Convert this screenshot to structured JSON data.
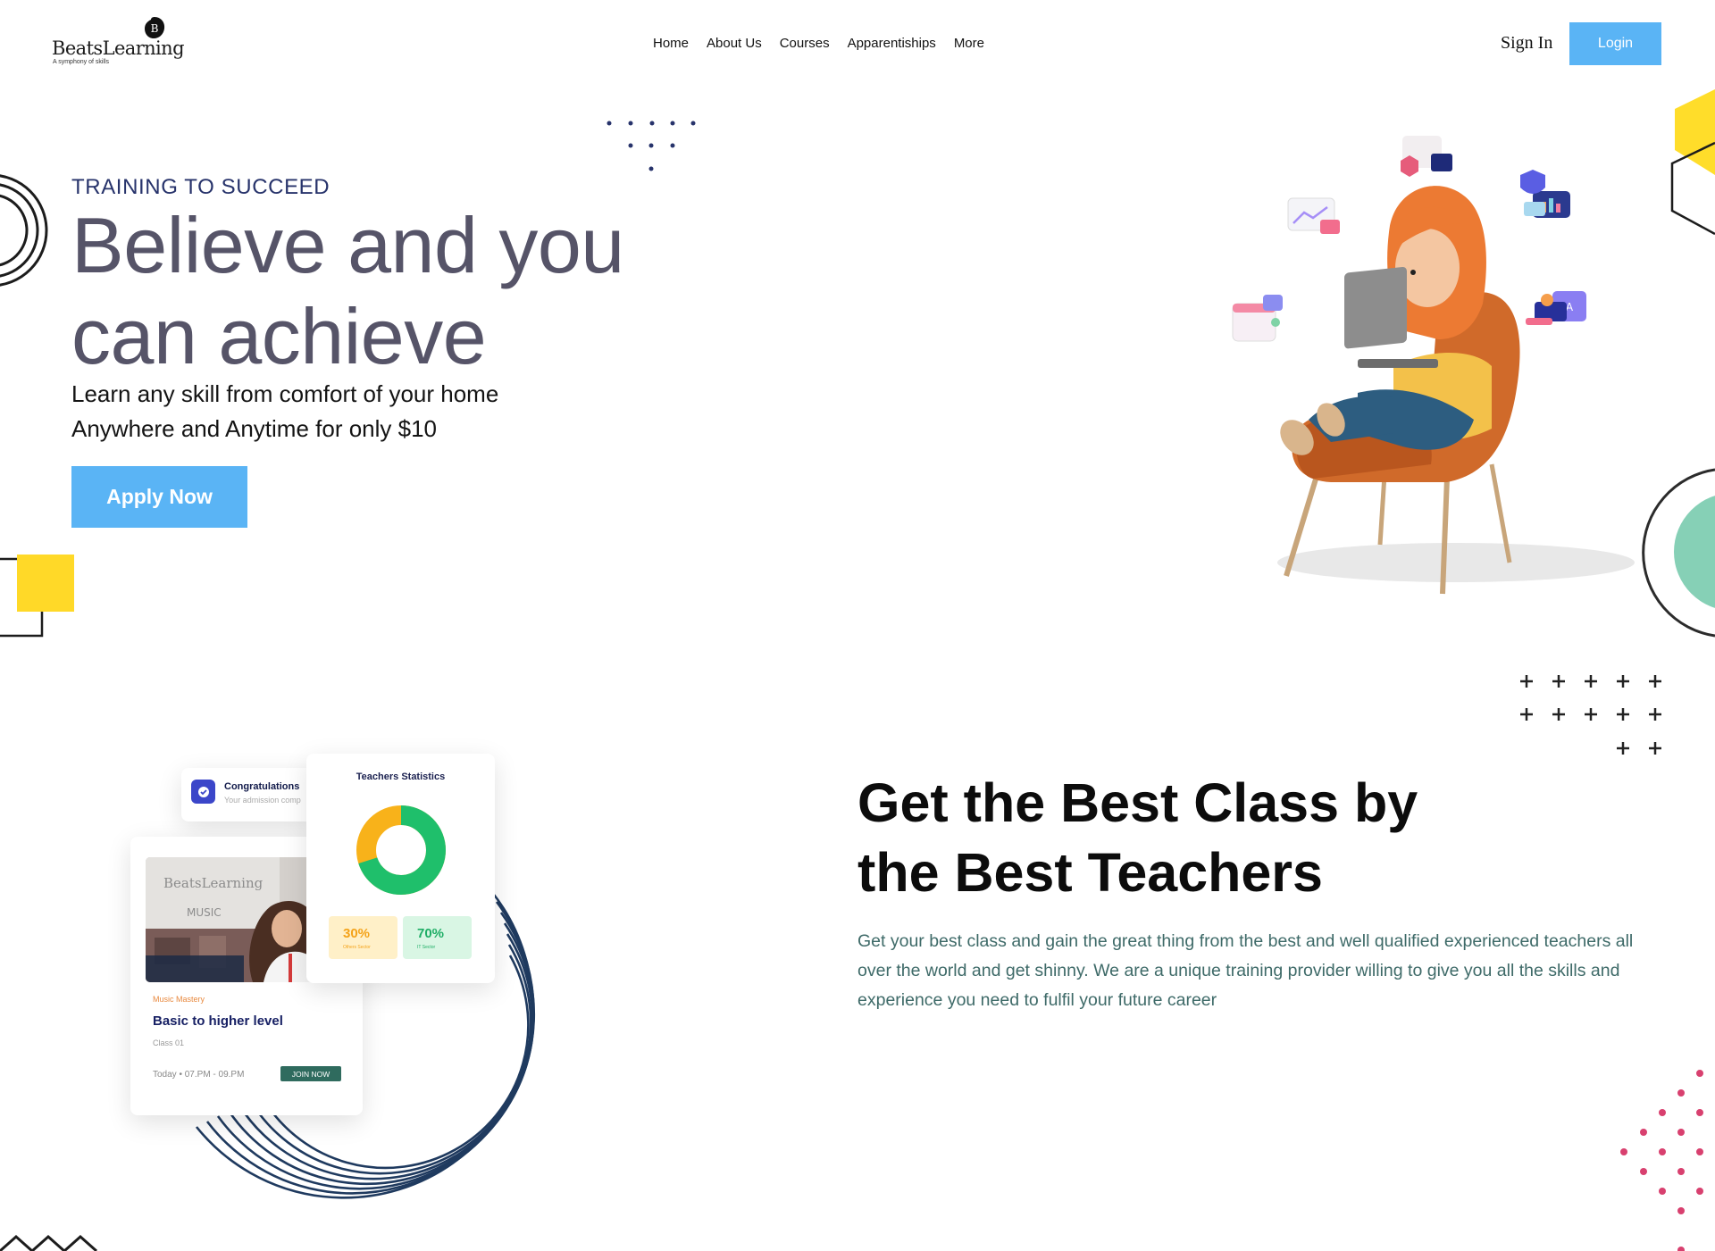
{
  "brand": {
    "name": "BeatsLearning",
    "tagline": "A symphony of skills",
    "badge_letter": "B",
    "accent": "#5ab4f5"
  },
  "nav": {
    "items": [
      "Home",
      "About Us",
      "Courses",
      "Apparentiships",
      "More"
    ],
    "sign_in": "Sign In",
    "login": "Login"
  },
  "hero": {
    "eyebrow": "TRAINING TO SUCCEED",
    "headline_line1": "Believe and you",
    "headline_line2": "can achieve",
    "sub_line1": "Learn any skill from comfort of your home",
    "sub_line2": "Anywhere and Anytime for only $10",
    "cta": "Apply Now"
  },
  "section2": {
    "heading_line1": "Get the Best Class by",
    "heading_line2": "the Best Teachers",
    "body": "Get your best class and gain the great thing from the best and well qualified experienced teachers all over the world and get shinny. We are a unique training provider willing to give you all the skills and experience you need to fulfil your future career"
  },
  "cards": {
    "congrats_title": "Congratulations",
    "congrats_text": "Your admission comp",
    "photo_brand": "BeatsLearning",
    "photo_sign": "MUSIC",
    "course_tag": "Music Mastery",
    "course_title": "Basic to higher level",
    "course_class": "Class 01",
    "course_time": "Today • 07.PM - 09.PM",
    "join": "JOIN NOW",
    "stats_title": "Teachers Statistics",
    "stat1_value": "30%",
    "stat1_label": "Others Sector",
    "stat2_value": "70%",
    "stat2_label": "IT Sector",
    "donut_share": 0.7,
    "colors": {
      "primary": "#1fbf6b",
      "secondary": "#f8b21a"
    }
  }
}
